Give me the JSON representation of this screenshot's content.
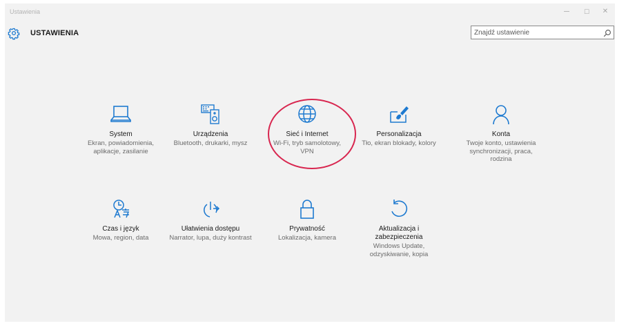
{
  "window": {
    "title": "Ustawienia",
    "controls": {
      "minimize": "─",
      "maximize": "☐",
      "close": "✕"
    }
  },
  "header": {
    "icon": "gear-icon",
    "title": "USTAWIENIA"
  },
  "search": {
    "placeholder": "Znajdź ustawienie",
    "icon": "search-icon"
  },
  "colors": {
    "accent": "#1e7ad0",
    "highlight": "#d8264f",
    "background": "#f2f2f2"
  },
  "tiles": [
    {
      "id": "system",
      "icon": "laptop-icon",
      "name": "System",
      "desc": "Ekran, powiadomienia, aplikacje, zasilanie"
    },
    {
      "id": "devices",
      "icon": "keyboard-speaker-icon",
      "name": "Urządzenia",
      "desc": "Bluetooth, drukarki, mysz"
    },
    {
      "id": "network",
      "icon": "globe-icon",
      "name": "Sieć i Internet",
      "desc": "Wi-Fi, tryb samolotowy, VPN"
    },
    {
      "id": "personalization",
      "icon": "paintbrush-icon",
      "name": "Personalizacja",
      "desc": "Tło, ekran blokady, kolory"
    },
    {
      "id": "accounts",
      "icon": "person-icon",
      "name": "Konta",
      "desc": "Twoje konto, ustawienia synchronizacji, praca, rodzina"
    },
    {
      "id": "time-language",
      "icon": "clock-language-icon",
      "name": "Czas i język",
      "desc": "Mowa, region, data"
    },
    {
      "id": "ease-of-access",
      "icon": "accessibility-icon",
      "name": "Ułatwienia dostępu",
      "desc": "Narrator, lupa, duży kontrast"
    },
    {
      "id": "privacy",
      "icon": "lock-icon",
      "name": "Prywatność",
      "desc": "Lokalizacja, kamera"
    },
    {
      "id": "update-security",
      "icon": "refresh-icon",
      "name": "Aktualizacja i zabezpieczenia",
      "desc": "Windows Update, odzyskiwanie, kopia"
    }
  ]
}
